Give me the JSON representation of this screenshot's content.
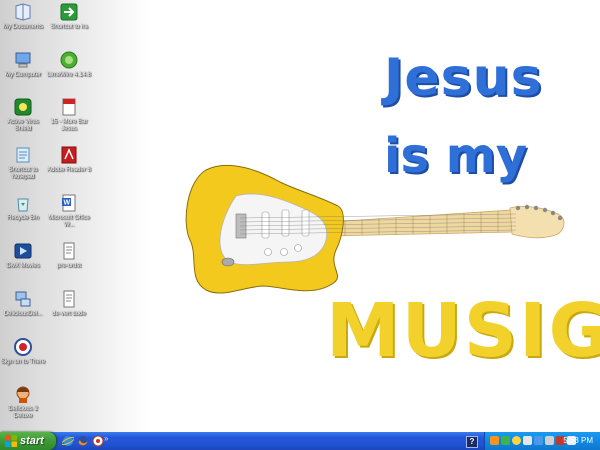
{
  "desktop": {
    "icons": [
      {
        "label": "My Documents",
        "icon": "my-documents-icon"
      },
      {
        "label": "Shortcut to ira",
        "icon": "shortcut-arrow-icon"
      },
      {
        "label": "My Computer",
        "icon": "my-computer-icon"
      },
      {
        "label": "LimeWire 4.14.8",
        "icon": "limewire-icon"
      },
      {
        "label": "Active Virus Shield",
        "icon": "antivirus-icon"
      },
      {
        "label": "15 - More Bar Jesus",
        "icon": "pdf-file-icon"
      },
      {
        "label": "Shortcut to Notepad",
        "icon": "notepad-icon"
      },
      {
        "label": "Adobe Reader 8",
        "icon": "adobe-reader-icon"
      },
      {
        "label": "Recycle Bin",
        "icon": "recycle-bin-icon"
      },
      {
        "label": "Microsoft Office W...",
        "icon": "word-document-icon"
      },
      {
        "label": "DivX Movies",
        "icon": "divx-icon"
      },
      {
        "label": "pre-ordst",
        "icon": "text-file-icon"
      },
      {
        "label": "DeliciousDel...",
        "icon": "network-icon"
      },
      {
        "label": "de-vert dude",
        "icon": "text-file-icon"
      },
      {
        "label": "Sign on to There",
        "icon": "there-signon-icon"
      },
      {
        "label": "Delicious 2 Deluxe",
        "icon": "delicious-game-icon"
      }
    ]
  },
  "wallpaper": {
    "line1": "Jesus",
    "line2": "is my",
    "line3": "MUSIG",
    "colors": {
      "blue_text": "#2f6fd8",
      "yellow_text": "#f2d22a",
      "guitar_body": "#f4cc1e",
      "guitar_neck": "#f1d9a0",
      "pickguard": "#f2f2f2"
    }
  },
  "taskbar": {
    "start_label": "start",
    "help_label": "?",
    "clock": "5:53 PM",
    "quick_launch": [
      "internet-explorer-icon",
      "firefox-icon",
      "media-icon"
    ],
    "quick_expand": "»",
    "tray_icons": [
      "tray-icon-1",
      "tray-icon-2",
      "tray-icon-3",
      "tray-icon-4",
      "tray-icon-5",
      "tray-icon-6",
      "tray-icon-7",
      "tray-icon-8",
      "tray-icon-9"
    ]
  }
}
